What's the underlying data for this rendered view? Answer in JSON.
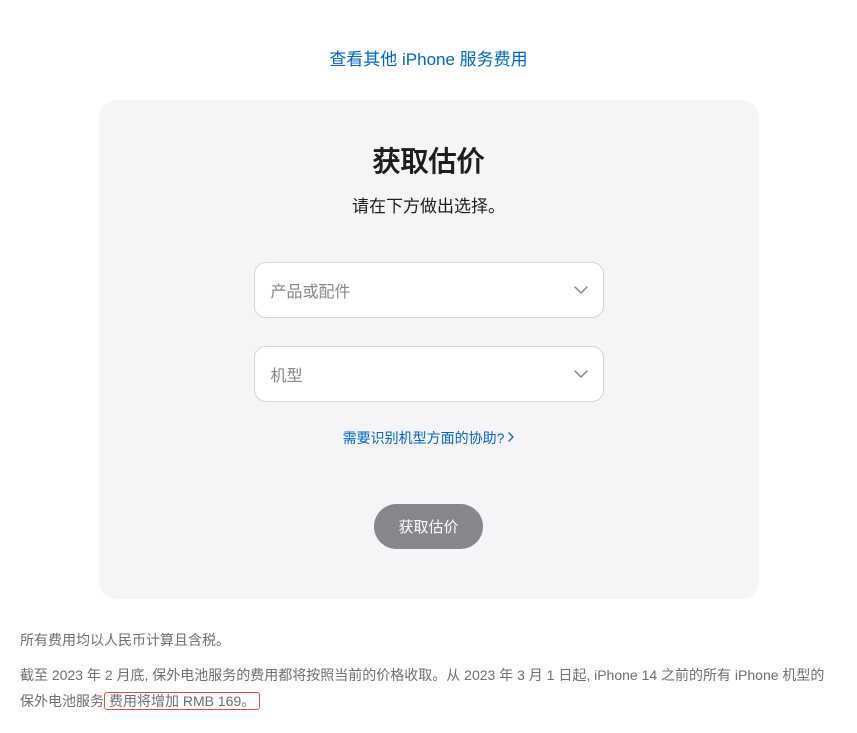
{
  "topLink": {
    "label": "查看其他 iPhone 服务费用"
  },
  "card": {
    "title": "获取估价",
    "subtitle": "请在下方做出选择。",
    "productSelect": {
      "placeholder": "产品或配件"
    },
    "modelSelect": {
      "placeholder": "机型"
    },
    "helpLink": {
      "label": "需要识别机型方面的协助?"
    },
    "submitButton": {
      "label": "获取估价"
    }
  },
  "footer": {
    "line1": "所有费用均以人民币计算且含税。",
    "line2_part1": "截至 2023 年 2 月底, 保外电池服务的费用都将按照当前的价格收取。从 2023 年 3 月 1 日起, iPhone 14 之前的所有 iPhone 机型的保外电池服务",
    "line2_highlight": "费用将增加 RMB 169。"
  }
}
